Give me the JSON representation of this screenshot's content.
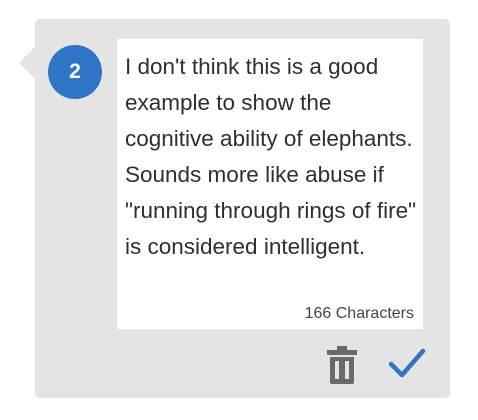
{
  "comment": {
    "number": "2",
    "text": "I don't think this is a good example to show the cognitive ability of elephants. Sounds more like abuse if \"running through rings of fire\" is considered intelligent.",
    "char_count_label": "166 Characters"
  },
  "actions": {
    "delete_icon": "trash-icon",
    "confirm_icon": "checkmark-icon"
  },
  "colors": {
    "panel_background": "#e4e4e4",
    "badge": "#2e74c7",
    "confirm": "#2e74c7",
    "delete": "#6a6a6a"
  }
}
